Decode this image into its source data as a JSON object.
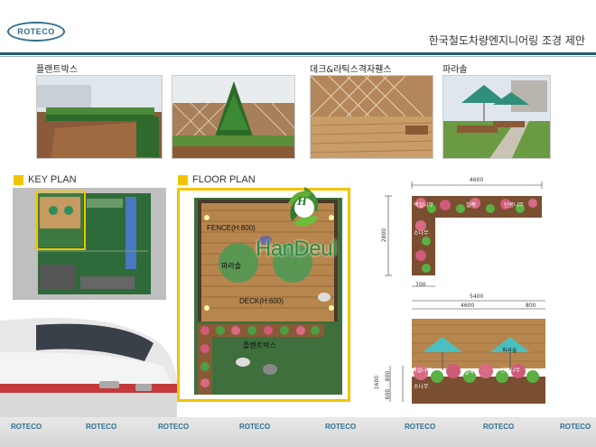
{
  "header": {
    "logo": "ROTECO",
    "title": "한국철도차량엔지니어링 조경 제안"
  },
  "photos": [
    {
      "label": "플랜트박스"
    },
    {
      "label": ""
    },
    {
      "label": "데크&라틱스격자휀스"
    },
    {
      "label": "파라솔"
    }
  ],
  "sections": {
    "key_plan": "KEY PLAN",
    "floor_plan": "FLOOR PLAN"
  },
  "floor_plan": {
    "fence": "FENCE(H:800)",
    "parasol": "파라솔",
    "deck": "DECK(H:600)",
    "plant_box": "플랜트박스"
  },
  "watermark": {
    "letter": "H",
    "text": "HanDeul"
  },
  "elevation": {
    "dim_top": "4600",
    "dim_side": "2800",
    "dim_700": "700",
    "dim_5400": "5400",
    "dim_4600": "4600",
    "dim_800": "800",
    "dim_1600": "1600",
    "dim_600": "600",
    "dim_800b": "800",
    "plan_labels": [
      "백일나무",
      "철쭉",
      "단풍나무",
      "소나무"
    ],
    "elev_labels": [
      "파라솔",
      "백일나무",
      "철쭉",
      "단풍나무",
      "소나무"
    ]
  },
  "footer": {
    "logos": [
      "ROTECO",
      "ROTECO",
      "ROTECO",
      "ROTECO",
      "ROTECO",
      "ROTECO",
      "ROTECO",
      "ROTECO"
    ]
  },
  "colors": {
    "accent": "#f2c400",
    "brand": "#1f5a73",
    "grass": "#3f7a3a",
    "deck": "#b7864e"
  }
}
